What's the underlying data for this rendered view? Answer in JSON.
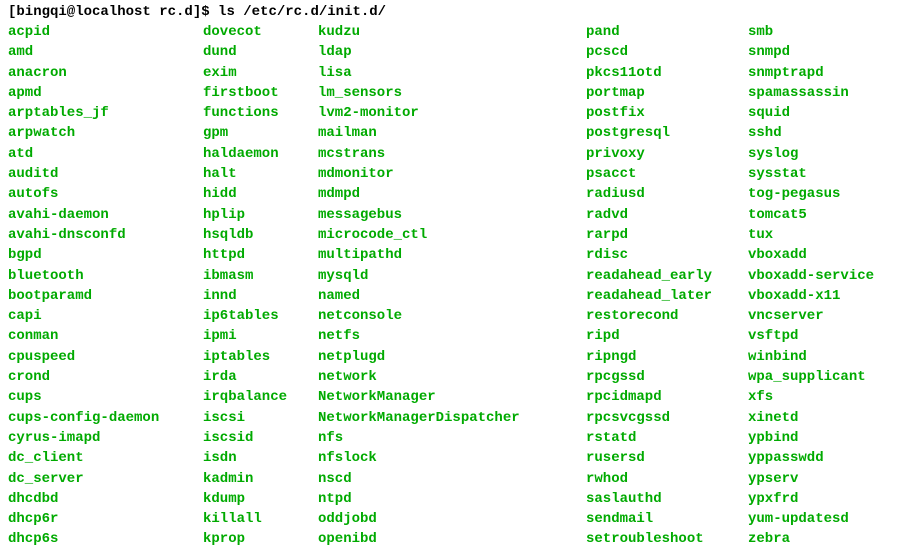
{
  "prompt": "[bingqi@localhost rc.d]$ ",
  "command": "ls /etc/rc.d/init.d/",
  "columns": [
    [
      "acpid",
      "amd",
      "anacron",
      "apmd",
      "arptables_jf",
      "arpwatch",
      "atd",
      "auditd",
      "autofs",
      "avahi-daemon",
      "avahi-dnsconfd",
      "bgpd",
      "bluetooth",
      "bootparamd",
      "capi",
      "conman",
      "cpuspeed",
      "crond",
      "cups",
      "cups-config-daemon",
      "cyrus-imapd",
      "dc_client",
      "dc_server",
      "dhcdbd",
      "dhcp6r",
      "dhcp6s"
    ],
    [
      "dovecot",
      "dund",
      "exim",
      "firstboot",
      "functions",
      "gpm",
      "haldaemon",
      "halt",
      "hidd",
      "hplip",
      "hsqldb",
      "httpd",
      "ibmasm",
      "innd",
      "ip6tables",
      "ipmi",
      "iptables",
      "irda",
      "irqbalance",
      "iscsi",
      "iscsid",
      "isdn",
      "kadmin",
      "kdump",
      "killall",
      "kprop"
    ],
    [
      "kudzu",
      "ldap",
      "lisa",
      "lm_sensors",
      "lvm2-monitor",
      "mailman",
      "mcstrans",
      "mdmonitor",
      "mdmpd",
      "messagebus",
      "microcode_ctl",
      "multipathd",
      "mysqld",
      "named",
      "netconsole",
      "netfs",
      "netplugd",
      "network",
      "NetworkManager",
      "NetworkManagerDispatcher",
      "nfs",
      "nfslock",
      "nscd",
      "ntpd",
      "oddjobd",
      "openibd"
    ],
    [
      "pand",
      "pcscd",
      "pkcs11otd",
      "portmap",
      "postfix",
      "postgresql",
      "privoxy",
      "psacct",
      "radiusd",
      "radvd",
      "rarpd",
      "rdisc",
      "readahead_early",
      "readahead_later",
      "restorecond",
      "ripd",
      "ripngd",
      "rpcgssd",
      "rpcidmapd",
      "rpcsvcgssd",
      "rstatd",
      "rusersd",
      "rwhod",
      "saslauthd",
      "sendmail",
      "setroubleshoot"
    ],
    [
      "smb",
      "snmpd",
      "snmptrapd",
      "spamassassin",
      "squid",
      "sshd",
      "syslog",
      "sysstat",
      "tog-pegasus",
      "tomcat5",
      "tux",
      "vboxadd",
      "vboxadd-service",
      "vboxadd-x11",
      "vncserver",
      "vsftpd",
      "winbind",
      "wpa_supplicant",
      "xfs",
      "xinetd",
      "ypbind",
      "yppasswdd",
      "ypserv",
      "ypxfrd",
      "yum-updatesd",
      "zebra"
    ]
  ]
}
